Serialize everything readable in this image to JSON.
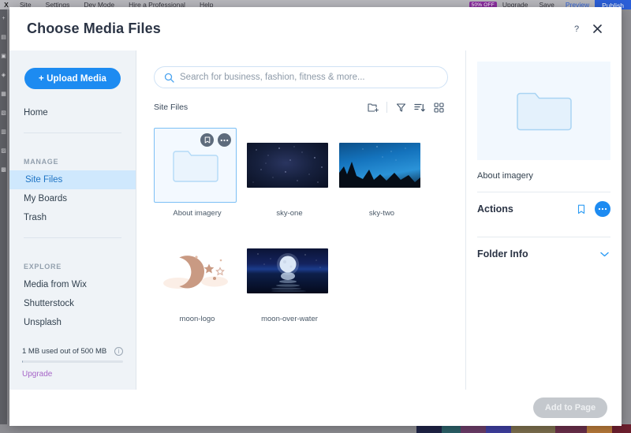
{
  "editor": {
    "left_menu": [
      "Site",
      "Settings",
      "Dev Mode",
      "Hire a Professional",
      "Help"
    ],
    "badge": "50% OFF",
    "upgrade": "Upgrade",
    "save": "Save",
    "preview": "Preview",
    "publish": "Publish"
  },
  "modal": {
    "title": "Choose Media Files",
    "help_icon": "question-mark-icon",
    "close_icon": "close-icon"
  },
  "sidebar": {
    "upload_button": "+ Upload Media",
    "home": "Home",
    "groups": [
      {
        "title": "MANAGE",
        "items": [
          "Site Files",
          "My Boards",
          "Trash"
        ]
      },
      {
        "title": "EXPLORE",
        "items": [
          "Media from Wix",
          "Shutterstock",
          "Unsplash"
        ]
      }
    ],
    "active_item": "Site Files",
    "storage_text": "1 MB used out of 500 MB",
    "storage_percent": 1,
    "storage_info_icon": "info-icon",
    "upgrade_link": "Upgrade"
  },
  "search": {
    "placeholder": "Search for business, fashion, fitness & more...",
    "value": "",
    "icon": "search-icon"
  },
  "toolbar": {
    "breadcrumb": "Site Files",
    "new_folder_icon": "folder-plus-icon",
    "filter_icon": "filter-icon",
    "sort_icon": "sort-descending-icon",
    "view_icon": "grid-view-icon"
  },
  "files": [
    {
      "name": "About imagery",
      "type": "folder",
      "selected": true,
      "overlay": {
        "bookmark_icon": "bookmark-icon",
        "more_icon": "ellipsis-icon"
      }
    },
    {
      "name": "sky-one",
      "type": "image",
      "selected": false
    },
    {
      "name": "sky-two",
      "type": "image",
      "selected": false
    },
    {
      "name": "moon-logo",
      "type": "image",
      "selected": false
    },
    {
      "name": "moon-over-water",
      "type": "image",
      "selected": false
    }
  ],
  "right_panel": {
    "preview_type": "folder",
    "preview_name": "About imagery",
    "actions_label": "Actions",
    "actions_bookmark_icon": "bookmark-icon",
    "actions_more_icon": "ellipsis-icon",
    "folder_info_label": "Folder Info",
    "folder_info_chevron": "chevron-down-icon"
  },
  "footer": {
    "add_button": "Add to Page",
    "add_button_disabled": true
  },
  "colors": {
    "accent_blue": "#1d8bf1",
    "selected_nav_bg": "#cfe8fd",
    "selected_nav_text": "#1d73c4",
    "upgrade_purple": "#a665c7",
    "disabled_button": "#c4c8cd",
    "sidebar_bg": "#eff3f7"
  }
}
